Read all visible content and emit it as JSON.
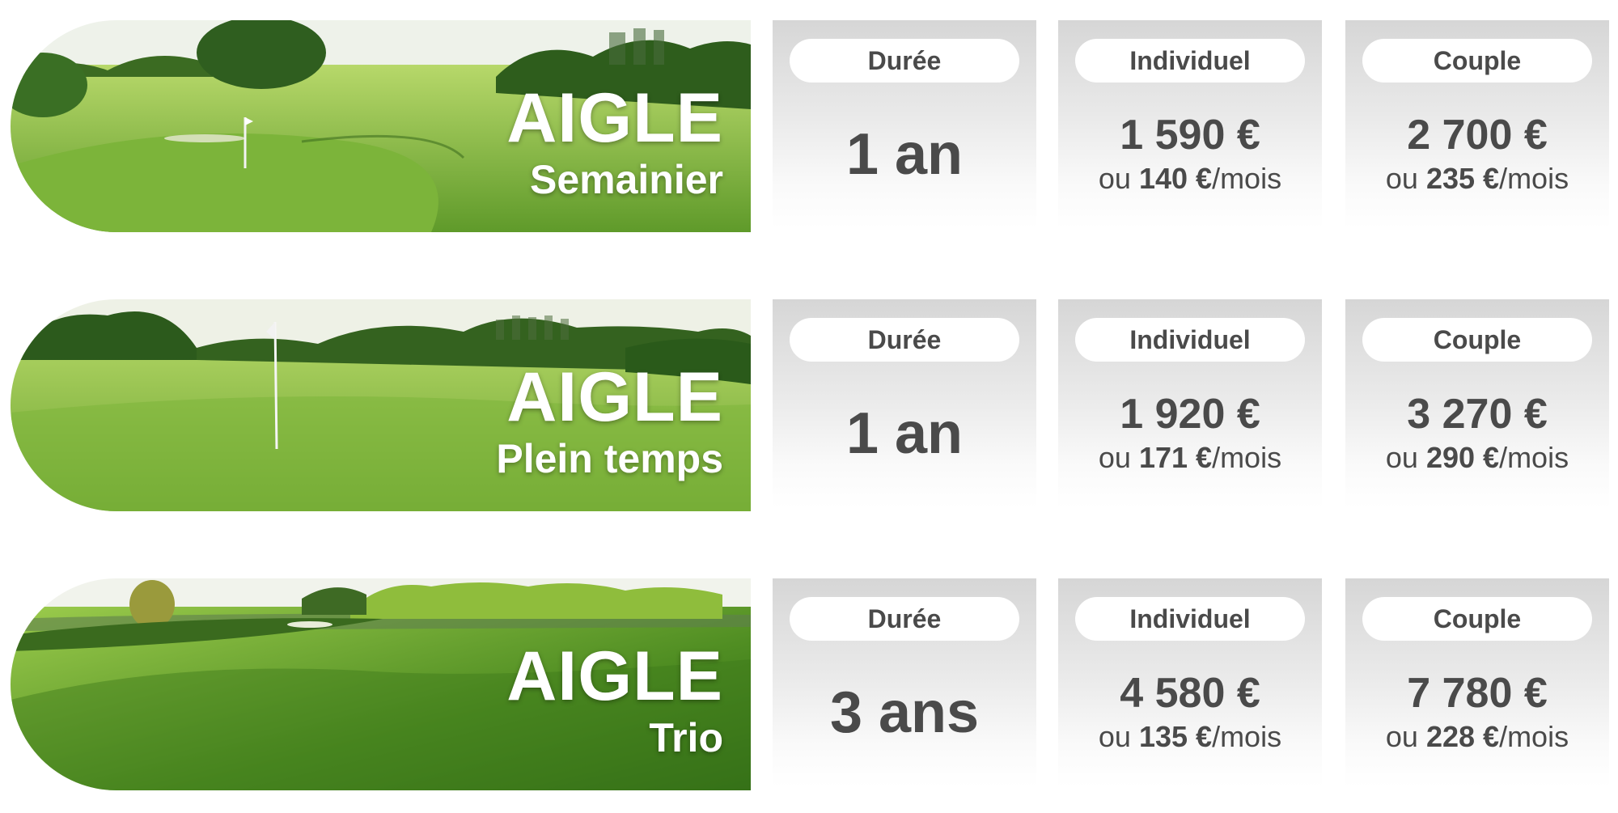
{
  "plans": [
    {
      "name": "AIGLE",
      "subtitle": "Semainier",
      "duree_label": "Durée",
      "duree": "1 an",
      "individuel_label": "Individuel",
      "individuel_price": "1 590 €",
      "individuel_prefix": "ou",
      "individuel_monthly": "140 €",
      "individuel_suffix": "/mois",
      "couple_label": "Couple",
      "couple_price": "2 700 €",
      "couple_prefix": "ou",
      "couple_monthly": "235 €",
      "couple_suffix": "/mois"
    },
    {
      "name": "AIGLE",
      "subtitle": "Plein temps",
      "duree_label": "Durée",
      "duree": "1 an",
      "individuel_label": "Individuel",
      "individuel_price": "1 920 €",
      "individuel_prefix": "ou",
      "individuel_monthly": "171 €",
      "individuel_suffix": "/mois",
      "couple_label": "Couple",
      "couple_price": "3 270 €",
      "couple_prefix": "ou",
      "couple_monthly": "290 €",
      "couple_suffix": "/mois"
    },
    {
      "name": "AIGLE",
      "subtitle": "Trio",
      "duree_label": "Durée",
      "duree": "3 ans",
      "individuel_label": "Individuel",
      "individuel_price": "4 580 €",
      "individuel_prefix": "ou",
      "individuel_monthly": "135 €",
      "individuel_suffix": "/mois",
      "couple_label": "Couple",
      "couple_price": "7 780 €",
      "couple_prefix": "ou",
      "couple_monthly": "228 €",
      "couple_suffix": "/mois"
    }
  ],
  "colors": {
    "text": "#4a4a4a",
    "card_top": "#d6d6d6",
    "pill": "#ffffff",
    "grass_light": "#8fc04a",
    "grass_dark": "#4e8a22",
    "trees": "#2f5e1f",
    "sky": "#eef2ea"
  },
  "images": [
    "golf-course-photo",
    "golf-course-photo",
    "golf-course-photo"
  ],
  "icons": [
    "flag-icon"
  ]
}
